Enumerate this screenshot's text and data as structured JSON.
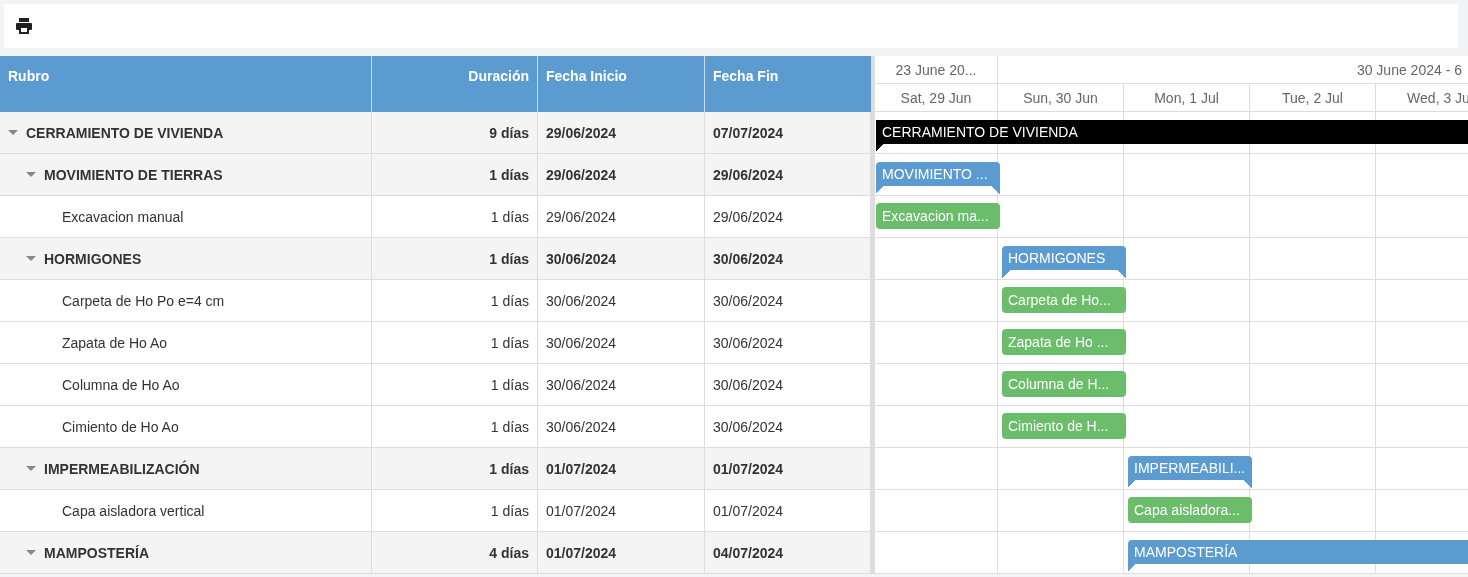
{
  "toolbar": {
    "buttons": [
      {
        "kind": "print"
      }
    ]
  },
  "columns": [
    {
      "label": "Rubro"
    },
    {
      "label": "Duración"
    },
    {
      "label": "Fecha Inicio"
    },
    {
      "label": "Fecha Fin"
    }
  ],
  "timeline": {
    "weeks": [
      {
        "label": "23 June 20..."
      },
      {
        "label": "30 June 2024 - 6"
      }
    ],
    "days": [
      "Sat, 29 Jun",
      "Sun, 30 Jun",
      "Mon, 1 Jul",
      "Tue, 2 Jul",
      "Wed, 3 Ju"
    ]
  },
  "rows": [
    {
      "kind": "summary",
      "name": "CERRAMIENTO DE VIVIENDA",
      "duration": "9 días",
      "start": "29/06/2024",
      "end": "07/07/2024",
      "expanded": true,
      "bar_label": "CERRAMIENTO DE VIVIENDA",
      "children": [
        {
          "kind": "summary",
          "name": "MOVIMIENTO DE TIERRAS",
          "duration": "1 días",
          "start": "29/06/2024",
          "end": "29/06/2024",
          "expanded": true,
          "bar_label": "MOVIMIENTO ...",
          "children": [
            {
              "kind": "task",
              "name": "Excavacion manual",
              "duration": "1 días",
              "start": "29/06/2024",
              "end": "29/06/2024",
              "bar_label": "Excavacion ma..."
            }
          ]
        },
        {
          "kind": "summary",
          "name": "HORMIGONES",
          "duration": "1 días",
          "start": "30/06/2024",
          "end": "30/06/2024",
          "expanded": true,
          "bar_label": "HORMIGONES",
          "children": [
            {
              "kind": "task",
              "name": "Carpeta de Ho Po e=4 cm",
              "duration": "1 días",
              "start": "30/06/2024",
              "end": "30/06/2024",
              "bar_label": "Carpeta de Ho..."
            },
            {
              "kind": "task",
              "name": "Zapata de Ho Ao",
              "duration": "1 días",
              "start": "30/06/2024",
              "end": "30/06/2024",
              "bar_label": "Zapata de Ho ..."
            },
            {
              "kind": "task",
              "name": "Columna de Ho Ao",
              "duration": "1 días",
              "start": "30/06/2024",
              "end": "30/06/2024",
              "bar_label": "Columna de H..."
            },
            {
              "kind": "task",
              "name": "Cimiento de Ho Ao",
              "duration": "1 días",
              "start": "30/06/2024",
              "end": "30/06/2024",
              "bar_label": "Cimiento de H..."
            }
          ]
        },
        {
          "kind": "summary",
          "name": "IMPERMEABILIZACIÓN",
          "duration": "1 días",
          "start": "01/07/2024",
          "end": "01/07/2024",
          "expanded": true,
          "bar_label": "IMPERMEABILI...",
          "children": [
            {
              "kind": "task",
              "name": "Capa aisladora vertical",
              "duration": "1 días",
              "start": "01/07/2024",
              "end": "01/07/2024",
              "bar_label": "Capa aisladora..."
            }
          ]
        },
        {
          "kind": "summary",
          "name": "MAMPOSTERÍA",
          "duration": "4 días",
          "start": "01/07/2024",
          "end": "04/07/2024",
          "expanded": true,
          "bar_label": "MAMPOSTERÍA"
        }
      ]
    }
  ]
}
